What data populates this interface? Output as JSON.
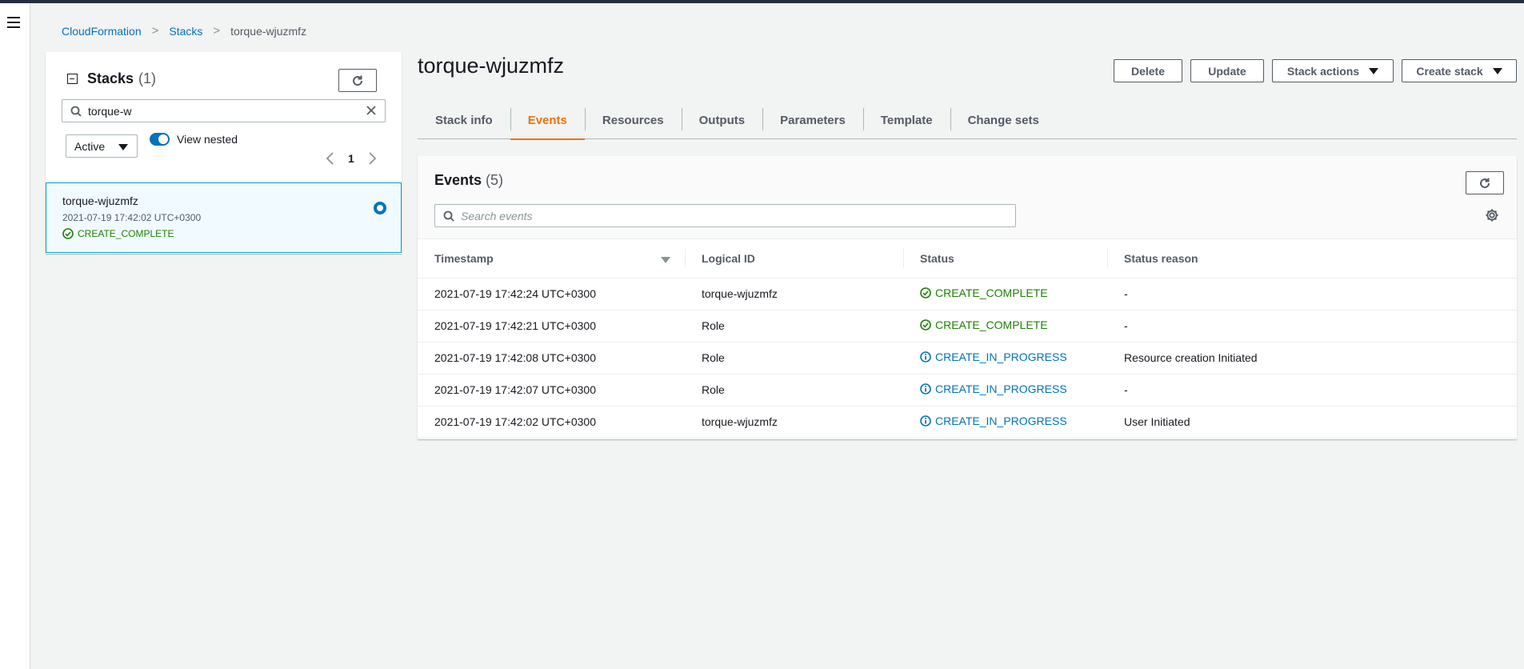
{
  "breadcrumb": {
    "root": "CloudFormation",
    "section": "Stacks",
    "current": "torque-wjuzmfz"
  },
  "stacks_panel": {
    "title": "Stacks",
    "count": "(1)",
    "search_value": "torque-w",
    "filter_value": "Active",
    "view_nested_label": "View nested",
    "view_nested_on": true,
    "page": "1",
    "selected_stack": {
      "name": "torque-wjuzmfz",
      "date": "2021-07-19 17:42:02 UTC+0300",
      "status": "CREATE_COMPLETE"
    }
  },
  "stack": {
    "name": "torque-wjuzmfz",
    "actions": {
      "delete": "Delete",
      "update": "Update",
      "stack_actions": "Stack actions",
      "create_stack": "Create stack"
    }
  },
  "tabs": [
    {
      "label": "Stack info",
      "active": false
    },
    {
      "label": "Events",
      "active": true
    },
    {
      "label": "Resources",
      "active": false
    },
    {
      "label": "Outputs",
      "active": false
    },
    {
      "label": "Parameters",
      "active": false
    },
    {
      "label": "Template",
      "active": false
    },
    {
      "label": "Change sets",
      "active": false
    }
  ],
  "events": {
    "title": "Events",
    "count": "(5)",
    "search_placeholder": "Search events",
    "columns": [
      "Timestamp",
      "Logical ID",
      "Status",
      "Status reason"
    ],
    "rows": [
      {
        "timestamp": "2021-07-19 17:42:24 UTC+0300",
        "logical_id": "torque-wjuzmfz",
        "status": "CREATE_COMPLETE",
        "status_type": "complete",
        "reason": "-"
      },
      {
        "timestamp": "2021-07-19 17:42:21 UTC+0300",
        "logical_id": "Role",
        "status": "CREATE_COMPLETE",
        "status_type": "complete",
        "reason": "-"
      },
      {
        "timestamp": "2021-07-19 17:42:08 UTC+0300",
        "logical_id": "Role",
        "status": "CREATE_IN_PROGRESS",
        "status_type": "progress",
        "reason": "Resource creation Initiated"
      },
      {
        "timestamp": "2021-07-19 17:42:07 UTC+0300",
        "logical_id": "Role",
        "status": "CREATE_IN_PROGRESS",
        "status_type": "progress",
        "reason": "-"
      },
      {
        "timestamp": "2021-07-19 17:42:02 UTC+0300",
        "logical_id": "torque-wjuzmfz",
        "status": "CREATE_IN_PROGRESS",
        "status_type": "progress",
        "reason": "User Initiated"
      }
    ]
  },
  "colors": {
    "link": "#0073bb",
    "success": "#1d8102",
    "info": "#0073bb",
    "active_tab": "#ec7211",
    "selected_border": "#00a1c9"
  },
  "icons": [
    "menu-icon",
    "collapse-icon",
    "refresh-icon",
    "search-icon",
    "clear-icon",
    "caret-down-icon",
    "chevron-left-icon",
    "chevron-right-icon",
    "success-icon",
    "info-icon",
    "gear-icon",
    "sort-icon"
  ]
}
